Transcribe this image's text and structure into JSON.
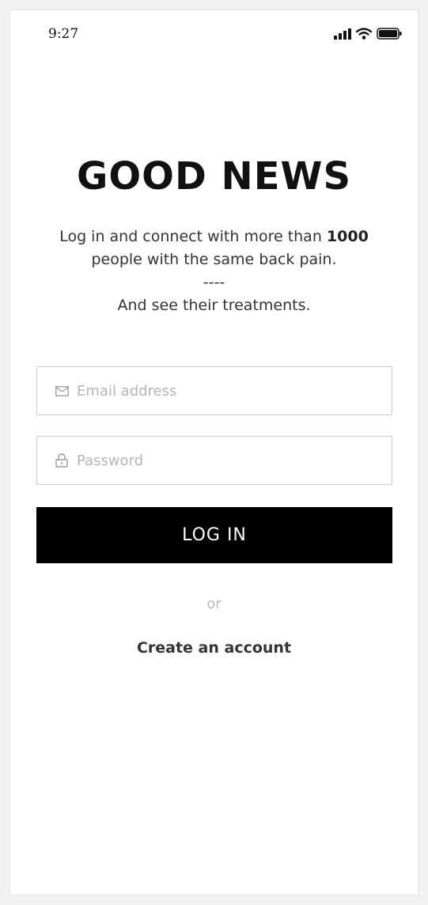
{
  "status_bar": {
    "time": "9:27"
  },
  "headline": "GOOD NEWS",
  "tagline": {
    "line1_prefix": "Log in and  connect with more than ",
    "line1_bold": "1000",
    "line2": "people with the same back pain.",
    "separator": "----",
    "line3": "And see their treatments."
  },
  "email": {
    "placeholder": "Email address",
    "icon": "mail-icon"
  },
  "password": {
    "placeholder": "Password",
    "icon": "lock-icon"
  },
  "login_button": "LOG IN",
  "divider_text": "or",
  "create_account_link": "Create an account",
  "colors": {
    "primary": "#000000",
    "text": "#333333",
    "muted": "#b5b5b5",
    "border": "#c9c9c9"
  }
}
